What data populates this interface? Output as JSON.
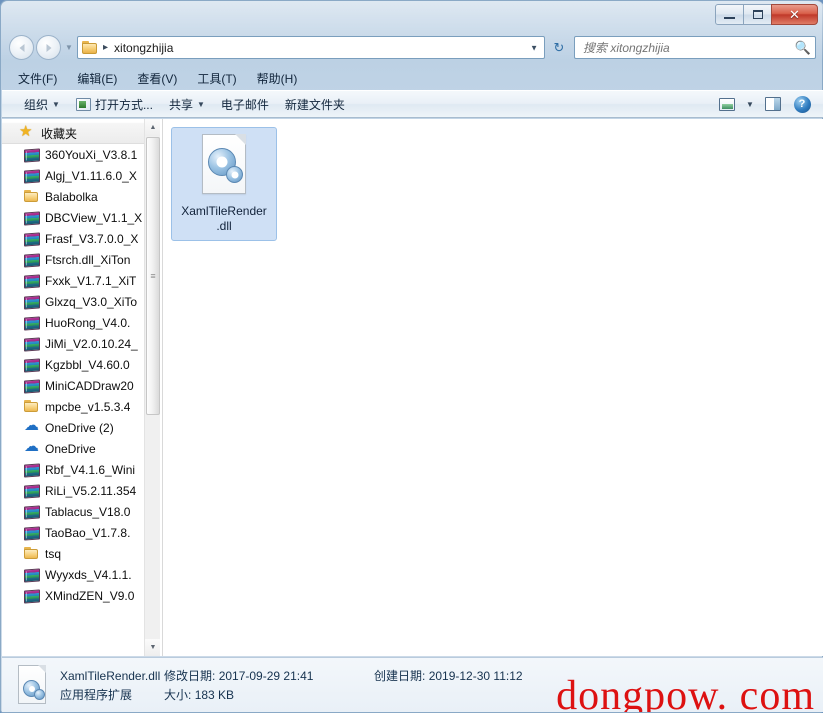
{
  "window": {
    "controls": {
      "minimize_label": "Minimize",
      "maximize_label": "Maximize",
      "close_label": "✕"
    }
  },
  "navigation": {
    "back_label": "◀",
    "forward_label": "▶",
    "recent_dropdown_label": "▼",
    "breadcrumb_separator": "▸",
    "current_folder": "xitongzhijia",
    "address_chevron": "▼",
    "refresh_label": "↻"
  },
  "search": {
    "placeholder": "搜索 xitongzhijia",
    "value": "",
    "icon": "search-icon"
  },
  "menubar": {
    "items": [
      {
        "label": "文件(F)"
      },
      {
        "label": "编辑(E)"
      },
      {
        "label": "查看(V)"
      },
      {
        "label": "工具(T)"
      },
      {
        "label": "帮助(H)"
      }
    ]
  },
  "toolbar": {
    "organize_label": "组织",
    "organize_caret": "▼",
    "open_with_label": "打开方式...",
    "share_label": "共享",
    "share_caret": "▼",
    "email_label": "电子邮件",
    "new_folder_label": "新建文件夹",
    "view_caret": "▼"
  },
  "nav_pane": {
    "header": {
      "label": "收藏夹",
      "icon": "star-icon"
    },
    "items": [
      {
        "label": "360YouXi_V3.8.1",
        "icon": "archive-icon"
      },
      {
        "label": "Algj_V1.11.6.0_X",
        "icon": "archive-icon"
      },
      {
        "label": "Balabolka",
        "icon": "folder-icon"
      },
      {
        "label": "DBCView_V1.1_X",
        "icon": "archive-icon"
      },
      {
        "label": "Frasf_V3.7.0.0_X",
        "icon": "archive-icon"
      },
      {
        "label": "Ftsrch.dll_XiTon",
        "icon": "archive-icon"
      },
      {
        "label": "Fxxk_V1.7.1_XiT",
        "icon": "archive-icon"
      },
      {
        "label": "Glxzq_V3.0_XiTo",
        "icon": "archive-icon"
      },
      {
        "label": "HuoRong_V4.0.",
        "icon": "archive-icon"
      },
      {
        "label": "JiMi_V2.0.10.24_",
        "icon": "archive-icon"
      },
      {
        "label": "Kgzbbl_V4.60.0",
        "icon": "archive-icon"
      },
      {
        "label": "MiniCADDraw20",
        "icon": "archive-icon"
      },
      {
        "label": "mpcbe_v1.5.3.4",
        "icon": "folder-icon"
      },
      {
        "label": "OneDrive (2)",
        "icon": "cloud-icon"
      },
      {
        "label": "OneDrive",
        "icon": "cloud-icon"
      },
      {
        "label": "Rbf_V4.1.6_Wini",
        "icon": "archive-icon"
      },
      {
        "label": "RiLi_V5.2.11.354",
        "icon": "archive-icon"
      },
      {
        "label": "Tablacus_V18.0",
        "icon": "archive-icon"
      },
      {
        "label": "TaoBao_V1.7.8.",
        "icon": "archive-icon"
      },
      {
        "label": "tsq",
        "icon": "folder-icon"
      },
      {
        "label": "Wyyxds_V4.1.1.",
        "icon": "archive-icon"
      },
      {
        "label": "XMindZEN_V9.0",
        "icon": "archive-icon"
      }
    ],
    "scrollbar": {
      "up_arrow": "▲",
      "down_arrow": "▼"
    }
  },
  "file_pane": {
    "files": [
      {
        "name_line1": "XamlTileRender",
        "name_line2": ".dll",
        "icon": "dll-file-icon",
        "selected": true
      }
    ]
  },
  "status_bar": {
    "file_name": "XamlTileRender.dll",
    "file_type": "应用程序扩展",
    "modified_label": "修改日期:",
    "modified_value": "2017-09-29 21:41",
    "created_label": "创建日期:",
    "created_value": "2019-12-30 11:12",
    "size_label": "大小:",
    "size_value": "183 KB"
  },
  "watermark": {
    "text": "dongpow. com",
    "color": "#dd1111"
  }
}
